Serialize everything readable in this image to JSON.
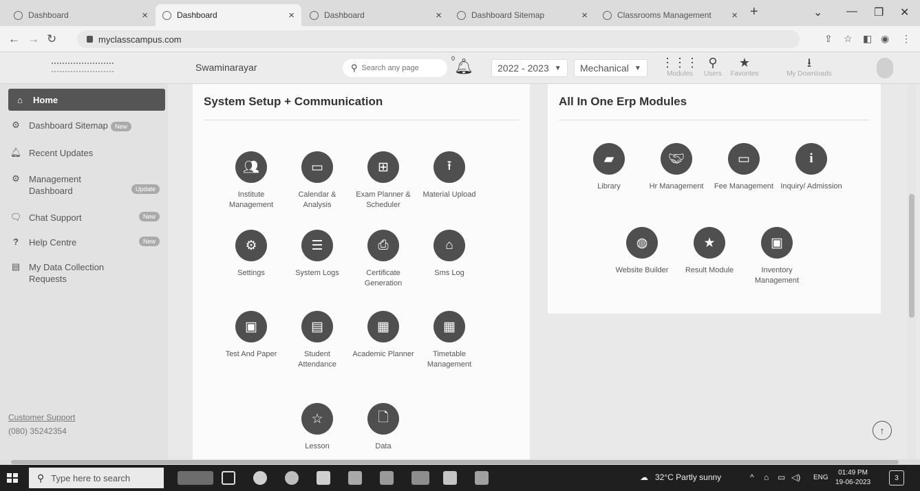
{
  "tabs": [
    {
      "title": "Dashboard",
      "active": false
    },
    {
      "title": "Dashboard",
      "active": true
    },
    {
      "title": "Dashboard",
      "active": false
    },
    {
      "title": "Dashboard Sitemap",
      "active": false
    },
    {
      "title": "Classrooms Management",
      "active": false
    }
  ],
  "browser": {
    "url": "myclasscampus.com"
  },
  "header": {
    "institute": "Swaminarayar",
    "search_placeholder": "Search any page",
    "notification_count": "0",
    "year": "2022 - 2023",
    "department": "Mechanical",
    "quick_links": [
      {
        "label": "Modules",
        "icon": "grid-icon"
      },
      {
        "label": "Users",
        "icon": "user-search-icon"
      },
      {
        "label": "Favorites",
        "icon": "star-icon"
      },
      {
        "label": "My Downloads",
        "icon": "download-icon"
      }
    ]
  },
  "sidebar": {
    "items": [
      {
        "label": "Home",
        "icon": "home-icon",
        "badge": ""
      },
      {
        "label": "Dashboard Sitemap",
        "icon": "sitemap-icon",
        "badge": "New"
      },
      {
        "label": "Recent Updates",
        "icon": "bell-icon",
        "badge": ""
      },
      {
        "label": "Management Dashboard",
        "icon": "gauge-icon",
        "badge": "Update"
      },
      {
        "label": "Chat Support",
        "icon": "chat-icon",
        "badge": "New"
      },
      {
        "label": "Help Centre",
        "icon": "help-icon",
        "badge": "New"
      },
      {
        "label": "My Data Collection Requests",
        "icon": "document-icon",
        "badge": ""
      }
    ],
    "support_label": "Customer Support",
    "support_phone": "(080) 35242354"
  },
  "panels": {
    "system": {
      "title": "System Setup + Communication",
      "modules": [
        {
          "label": "Institute Management",
          "icon": "users-icon"
        },
        {
          "label": "Calendar & Analysis",
          "icon": "calendar-icon"
        },
        {
          "label": "Exam Planner & Scheduler",
          "icon": "calendar-plus-icon"
        },
        {
          "label": "Material Upload",
          "icon": "upload-icon"
        },
        {
          "label": "Settings",
          "icon": "cogs-icon"
        },
        {
          "label": "System Logs",
          "icon": "server-icon"
        },
        {
          "label": "Certificate Generation",
          "icon": "printer-icon"
        },
        {
          "label": "Sms Log",
          "icon": "inbox-icon"
        },
        {
          "label": "Test And Paper",
          "icon": "id-card-icon"
        },
        {
          "label": "Student Attendance",
          "icon": "list-icon"
        },
        {
          "label": "Academic Planner",
          "icon": "calendar-grid-icon"
        },
        {
          "label": "Timetable Management",
          "icon": "calendar-grid-icon"
        },
        {
          "label": "Lesson",
          "icon": "star-outline-icon"
        },
        {
          "label": "Data",
          "icon": "file-icon"
        }
      ]
    },
    "erp": {
      "title": "All In One Erp Modules",
      "modules": [
        {
          "label": "Library",
          "icon": "book-icon"
        },
        {
          "label": "Hr Management",
          "icon": "handshake-icon"
        },
        {
          "label": "Fee Management",
          "icon": "money-icon"
        },
        {
          "label": "Inquiry/ Admission",
          "icon": "info-icon"
        },
        {
          "label": "Website Builder",
          "icon": "globe-icon"
        },
        {
          "label": "Result Module",
          "icon": "star-icon"
        },
        {
          "label": "Inventory Management",
          "icon": "id-badge-icon"
        }
      ]
    }
  },
  "taskbar": {
    "search_placeholder": "Type here to search",
    "weather": "32°C Partly sunny",
    "lang": "ENG",
    "time": "01:49 PM",
    "date": "19-06-2023",
    "notifications": "3"
  }
}
